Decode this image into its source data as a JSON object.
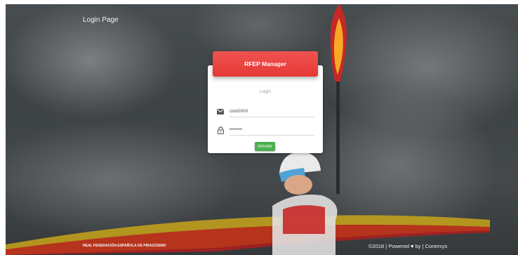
{
  "header": {
    "page_title": "Login Page"
  },
  "login_card": {
    "title": "RFEP Manager",
    "subtitle": "Login",
    "username_value": "club0000",
    "password_value": "••••••••",
    "submit_label": "ENVIAR",
    "accent_color": "#e53935",
    "button_color": "#4caf50"
  },
  "footer": {
    "organization": "REAL FEDERACIÓN ESPAÑOLA DE PIRAGÜISMO",
    "copyright": "©2018 | Powered",
    "by_label": "by | Conersys"
  },
  "icons": {
    "user": "envelope-icon",
    "password": "lock-icon",
    "heart": "heart-icon"
  }
}
